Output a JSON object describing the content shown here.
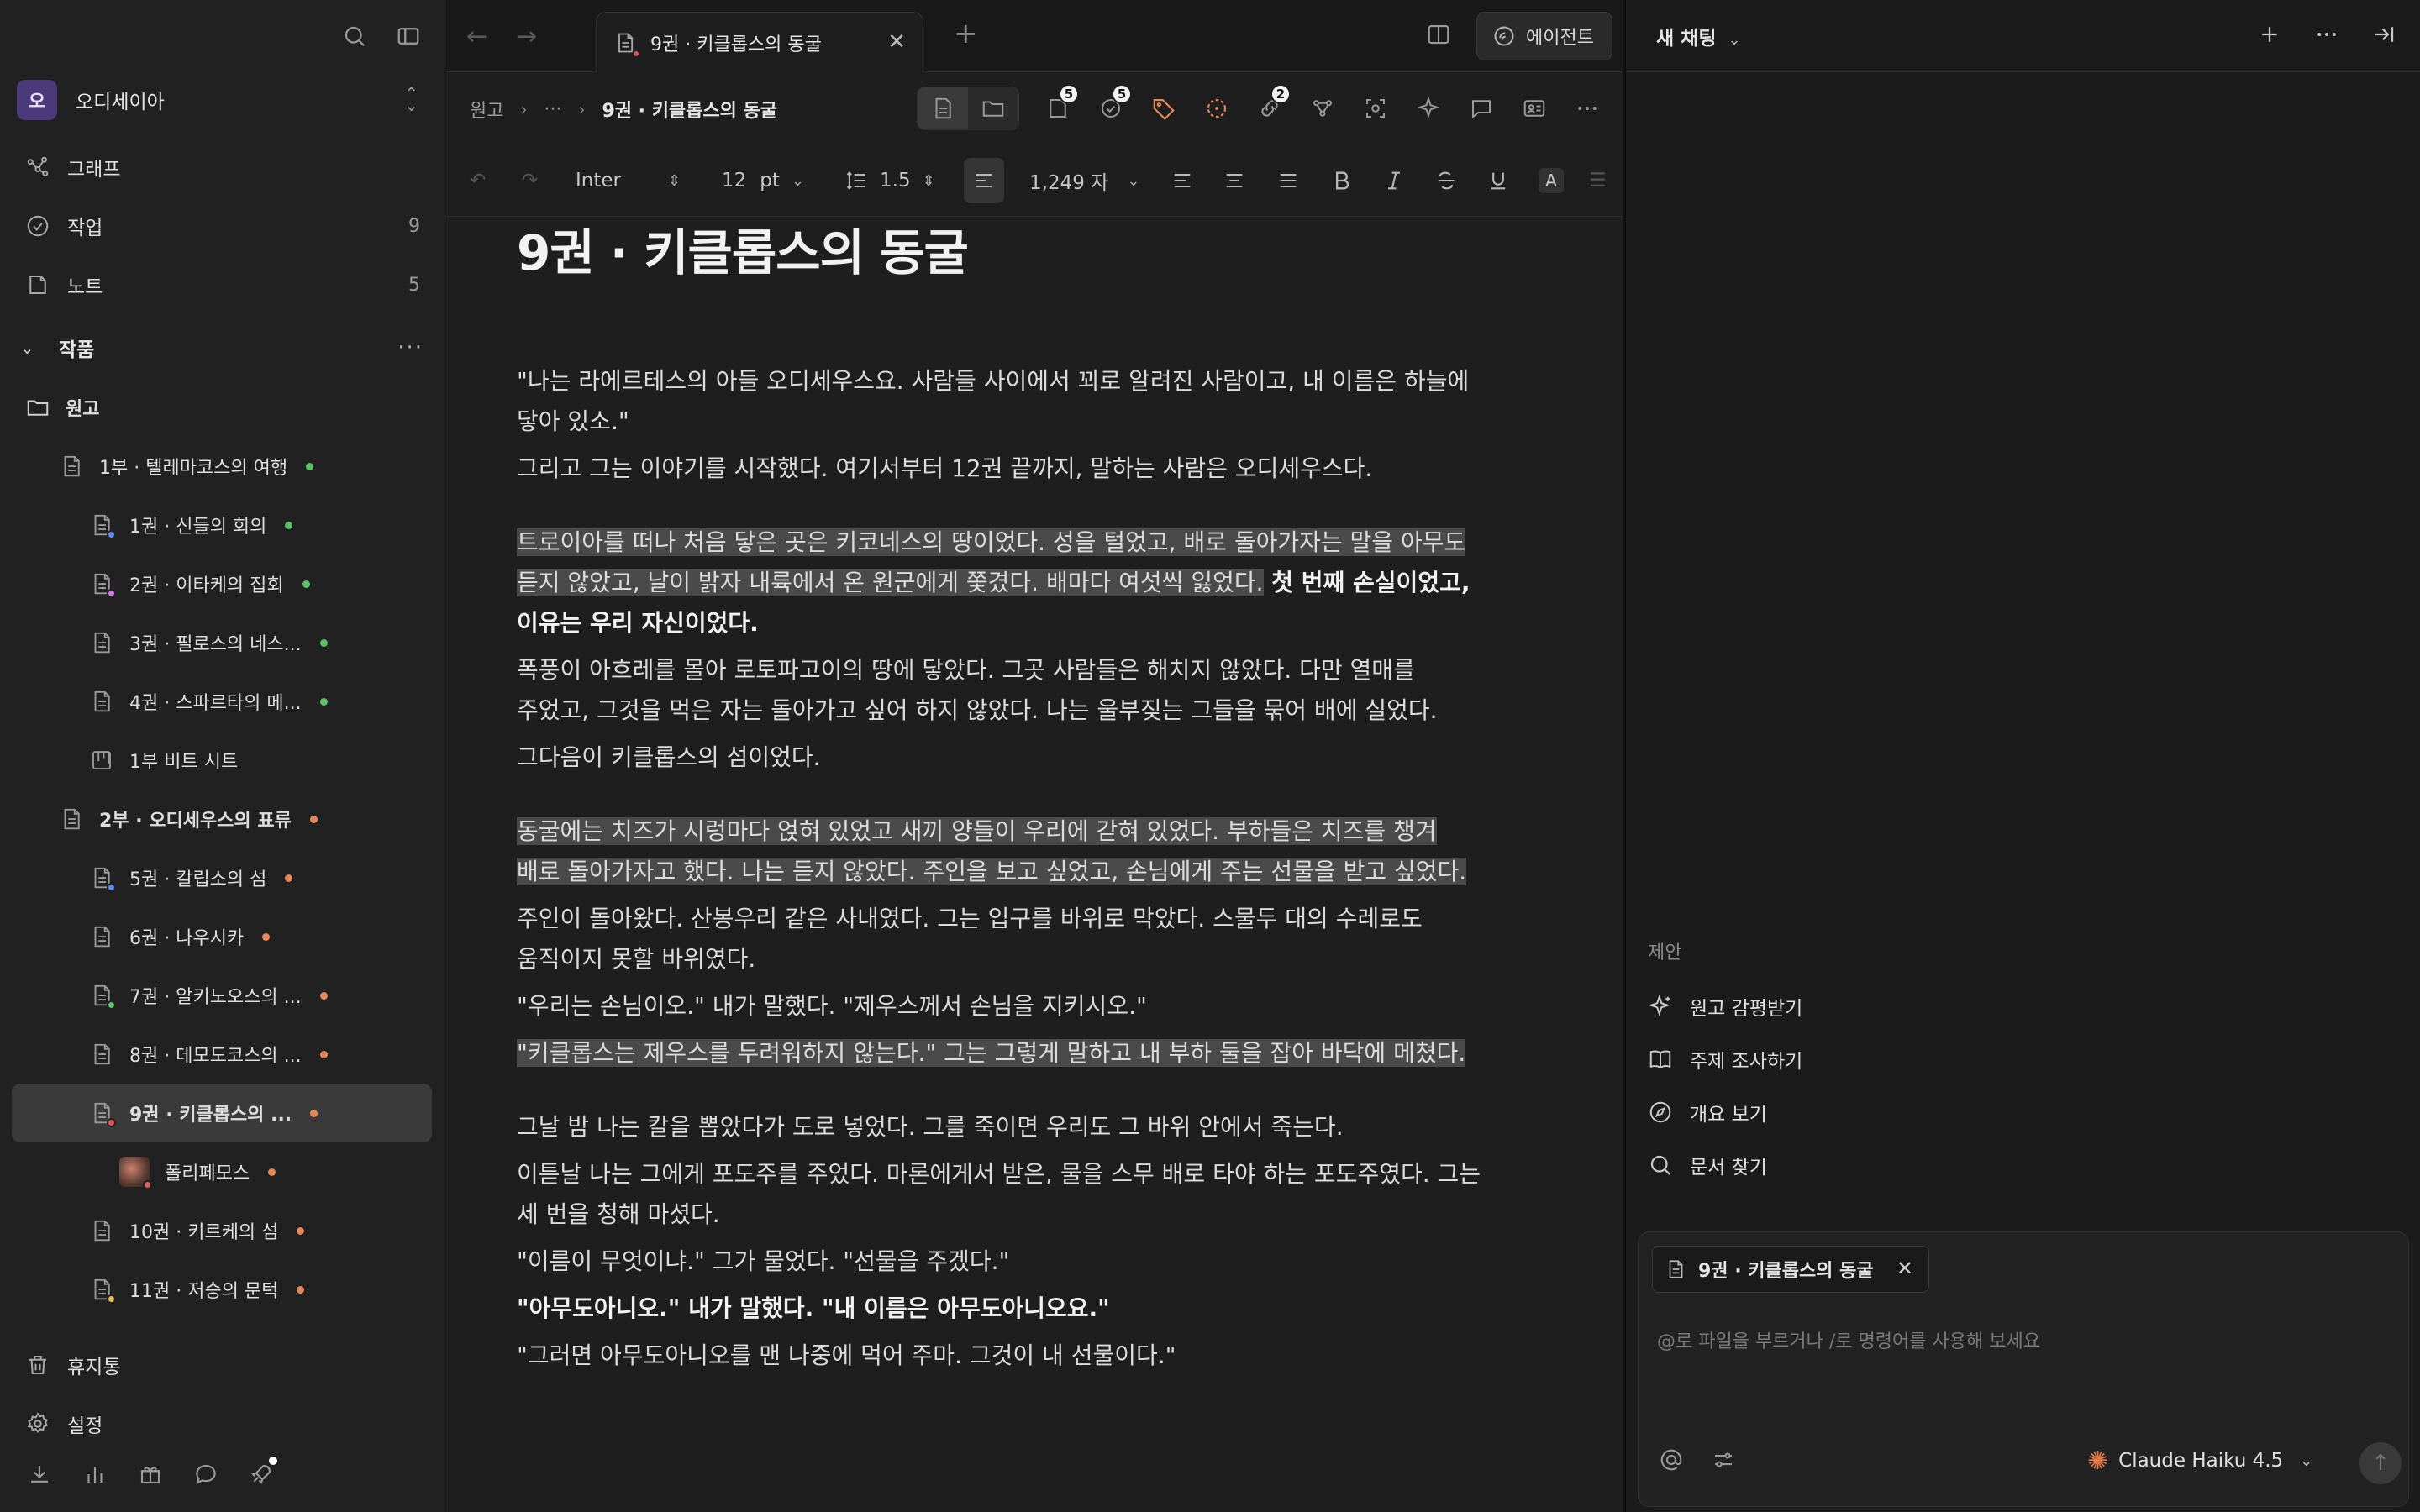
{
  "sidebar": {
    "workspace": {
      "avatar": "오",
      "name": "오디세이아"
    },
    "nav": [
      {
        "label": "그래프",
        "icon": "graph-icon",
        "count": ""
      },
      {
        "label": "작업",
        "icon": "check-circle-icon",
        "count": "9"
      },
      {
        "label": "노트",
        "icon": "note-icon",
        "count": "5"
      }
    ],
    "section": {
      "label": "작품"
    },
    "tree": [
      {
        "label": "원고",
        "type": "folder",
        "indent": 0,
        "dot": ""
      },
      {
        "label": "1부 · 텔레마코스의 여행",
        "type": "doc",
        "indent": 1,
        "dot": "#5cc36a"
      },
      {
        "label": "1권 · 신들의 회의",
        "type": "doc",
        "indent": 2,
        "dot": "#5cc36a",
        "mini": "#5a8ef0"
      },
      {
        "label": "2권 · 이타케의 집회",
        "type": "doc",
        "indent": 2,
        "dot": "#5cc36a",
        "mini": "#d07ae0"
      },
      {
        "label": "3권 · 필로스의 네스...",
        "type": "doc",
        "indent": 2,
        "dot": "#5cc36a"
      },
      {
        "label": "4권 · 스파르타의 메...",
        "type": "doc",
        "indent": 2,
        "dot": "#5cc36a"
      },
      {
        "label": "1부 비트 시트",
        "type": "board",
        "indent": 2,
        "dot": ""
      },
      {
        "label": "2부 · 오디세우스의 표류",
        "type": "doc",
        "indent": 1,
        "dot": "#e8875a",
        "bold": true
      },
      {
        "label": "5권 · 칼립소의 섬",
        "type": "doc",
        "indent": 2,
        "dot": "#e8875a",
        "mini": "#5a8ef0"
      },
      {
        "label": "6권 · 나우시카",
        "type": "doc",
        "indent": 2,
        "dot": "#e8875a"
      },
      {
        "label": "7권 · 알키노오스의 ...",
        "type": "doc",
        "indent": 2,
        "dot": "#e8875a",
        "mini": "#5cc36a"
      },
      {
        "label": "8권 · 데모도코스의 ...",
        "type": "doc",
        "indent": 2,
        "dot": "#e8875a"
      },
      {
        "label": "9권 · 키클롭스의 ...",
        "type": "doc",
        "indent": 2,
        "dot": "#e8875a",
        "mini": "#e05555",
        "active": true
      },
      {
        "label": "폴리페모스",
        "type": "image",
        "indent": 3,
        "dot": "#e8875a"
      },
      {
        "label": "10권 · 키르케의 섬",
        "type": "doc",
        "indent": 2,
        "dot": "#e8875a"
      },
      {
        "label": "11권 · 저승의 문턱",
        "type": "doc",
        "indent": 2,
        "dot": "#e8875a",
        "mini": "#e8c24a"
      }
    ],
    "bottom": [
      {
        "label": "휴지통",
        "icon": "trash-icon"
      },
      {
        "label": "설정",
        "icon": "gear-icon"
      }
    ]
  },
  "tabs": {
    "active_title": "9권 · 키클롭스의 동굴",
    "agent_label": "에이전트"
  },
  "breadcrumb": {
    "root": "원고",
    "ellipsis": "···",
    "current": "9권 · 키클롭스의 동굴"
  },
  "badges": {
    "notes": "5",
    "tasks": "5",
    "links": "2"
  },
  "format": {
    "font": "Inter",
    "size": "12",
    "unit": "pt",
    "line_height": "1.5",
    "char_count": "1,249 자"
  },
  "doc": {
    "title": "9권 · 키클롭스의 동굴",
    "p1": "\"나는 라에르테스의 아들 오디세우스요. 사람들 사이에서 꾀로 알려진 사람이고, 내 이름은 하늘에\n닿아 있소.\"",
    "p2": "그리고 그는 이야기를 시작했다. 여기서부터 12권 끝까지, 말하는 사람은 오디세우스다.",
    "p3_hl": "트로이아를 떠나 처음 닿은 곳은 키코네스의 땅이었다. 성을 털었고, 배로 돌아가자는 말을 아무도\n듣지 않았고, 날이 밝자 내륙에서 온 원군에게 쫓겼다. 배마다 여섯씩 잃었다.",
    "p3_bold": " 첫 번째 손실이었고,\n이유는 우리 자신이었다.",
    "p4": "폭풍이 아흐레를 몰아 로토파고이의 땅에 닿았다. 그곳 사람들은 해치지 않았다. 다만 열매를\n주었고, 그것을 먹은 자는 돌아가고 싶어 하지 않았다. 나는 울부짖는 그들을 묶어 배에 실었다.",
    "p5": "그다음이 키클롭스의 섬이었다.",
    "p6_hl": "동굴에는 치즈가 시렁마다 얹혀 있었고 새끼 양들이 우리에 갇혀 있었다. 부하들은 치즈를 챙겨\n배로 돌아가자고 했다. 나는 듣지 않았다. 주인을 보고 싶었고, 손님에게 주는 선물을 받고 싶었다.",
    "p7": "주인이 돌아왔다. 산봉우리 같은 사내였다. 그는 입구를 바위로 막았다. 스물두 대의 수레로도\n움직이지 못할 바위였다.",
    "p8": "\"우리는 손님이오.\" 내가 말했다. \"제우스께서 손님을 지키시오.\"",
    "p9_hl": "\"키클롭스는 제우스를 두려워하지 않는다.\" 그는 그렇게 말하고 내 부하 둘을 잡아 바닥에 메쳤다.",
    "p10": "그날 밤 나는 칼을 뽑았다가 도로 넣었다. 그를 죽이면 우리도 그 바위 안에서 죽는다.",
    "p11": "이튿날 나는 그에게 포도주를 주었다. 마론에게서 받은, 물을 스무 배로 타야 하는 포도주였다. 그는\n세 번을 청해 마셨다.",
    "p12": "\"이름이 무엇이냐.\" 그가 물었다. \"선물을 주겠다.\"",
    "p13_bold": "\"아무도아니오.\" 내가 말했다. \"내 이름은 아무도아니오요.\"",
    "p14": "\"그러면 아무도아니오를 맨 나중에 먹어 주마. 그것이 내 선물이다.\""
  },
  "chat": {
    "title": "새 채팅",
    "suggest_header": "제안",
    "suggestions": [
      {
        "label": "원고 감평받기",
        "icon": "sparkle-icon"
      },
      {
        "label": "주제 조사하기",
        "icon": "book-icon"
      },
      {
        "label": "개요 보기",
        "icon": "compass-icon"
      },
      {
        "label": "문서 찾기",
        "icon": "search-icon"
      }
    ],
    "chip_label": "9권 · 키클롭스의 동굴",
    "placeholder": "@로 파일을 부르거나 /로 명령어를 사용해 보세요",
    "model": "Claude Haiku 4.5"
  }
}
